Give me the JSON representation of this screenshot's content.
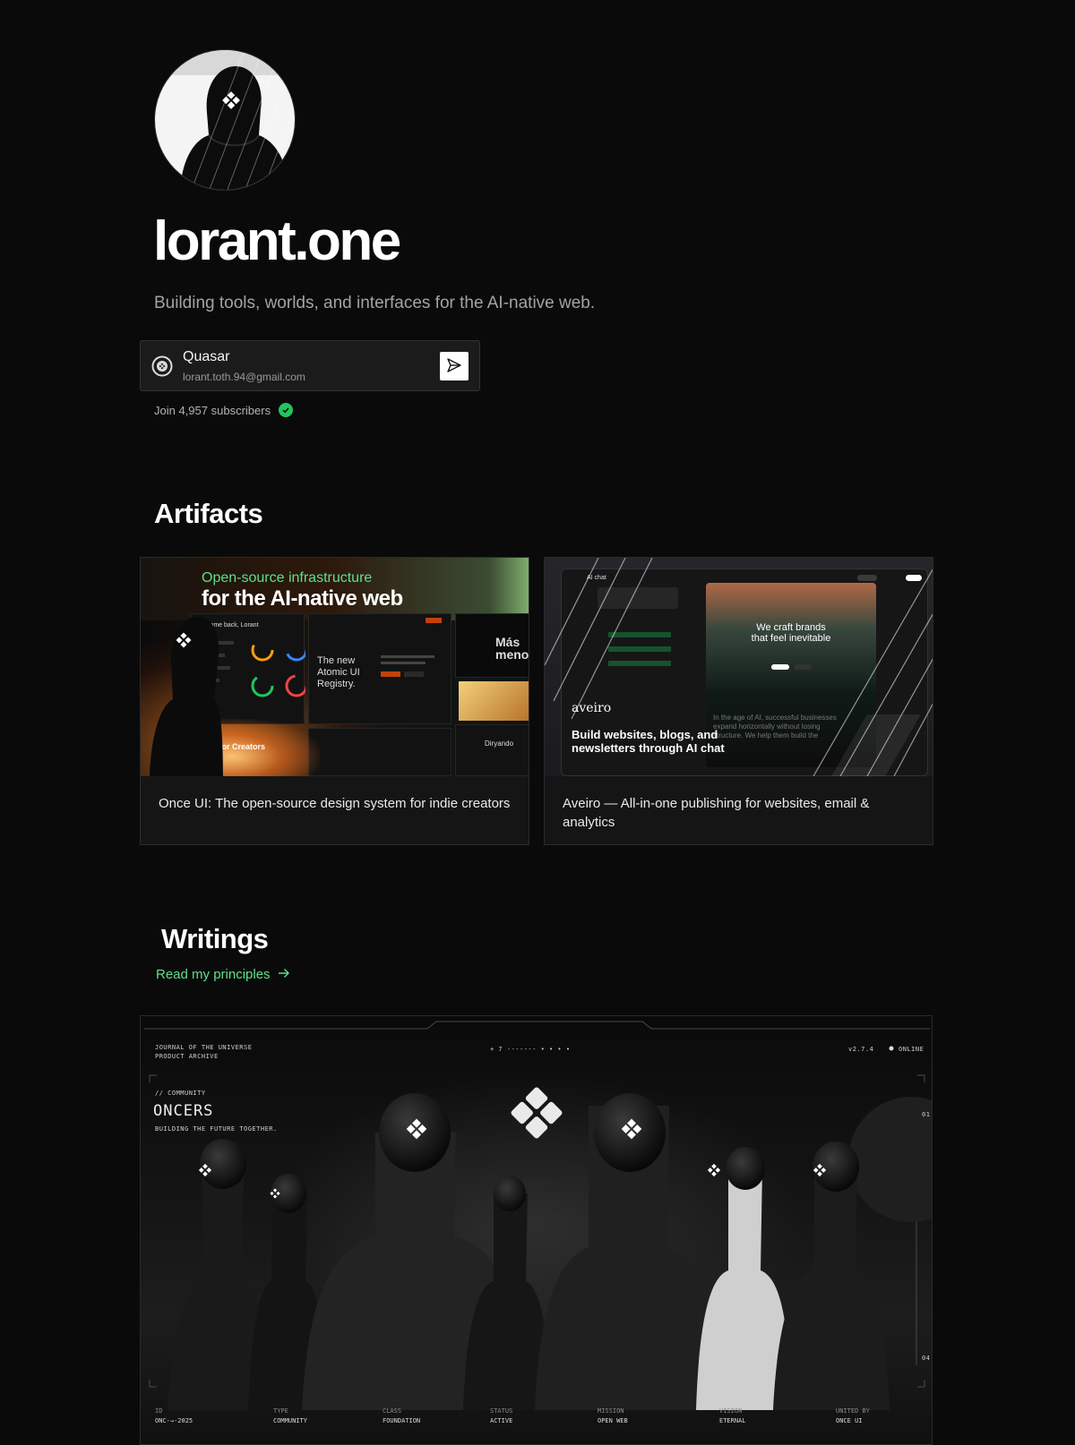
{
  "hero": {
    "brand": "lorant.one",
    "tagline": "Building tools, worlds, and interfaces for the AI-native web."
  },
  "subscribe": {
    "name": "Quasar",
    "email": "lorant.toth.94@gmail.com",
    "send_icon": "send-icon",
    "count_text": "Join 4,957 subscribers",
    "badge_icon": "check-icon",
    "badge_color": "#22c55e"
  },
  "artifacts": {
    "title": "Artifacts",
    "cards": [
      {
        "caption": "Once UI: The open-source design system for indie creators",
        "media": {
          "headline_1": "Open-source infrastructure",
          "headline_2": "for the AI-native web",
          "panel_1": "Welcome back, Lorant",
          "panel_2": "The new Atomic UI Registry.",
          "panel_3": "Más meno",
          "panel_4": "Diryando",
          "creators": "Home for Creators"
        }
      },
      {
        "caption": "Aveiro — All-in-one publishing for websites, email & analytics",
        "media": {
          "chat_label": "AI chat",
          "hero_1": "We craft brands",
          "hero_2": "that feel inevitable",
          "brand": "aveiro",
          "subline": "Build websites, blogs, and newsletters through AI chat",
          "body": "In the age of AI, successful businesses expand horizontally without losing structure. We help them build the"
        }
      }
    ]
  },
  "writings": {
    "title": "Writings",
    "link_label": "Read my principles",
    "link_icon": "arrow-right-icon",
    "accent": "#5ee08a",
    "feature": {
      "top_left_1": "JOURNAL OF THE UNIVERSE",
      "top_left_2": "PRODUCT ARCHIVE",
      "top_center": "+ 7 ------- • • • •",
      "version": "v2.7.4",
      "status": "ONLINE",
      "kicker": "// COMMUNITY",
      "title": "ONCERS",
      "subtitle": "BUILDING THE FUTURE TOGETHER.",
      "side_1": "01",
      "side_2": "04",
      "footer": [
        {
          "k": "ID",
          "v": "ONC-→-2025"
        },
        {
          "k": "TYPE",
          "v": "COMMUNITY"
        },
        {
          "k": "CLASS",
          "v": "FOUNDATION"
        },
        {
          "k": "STATUS",
          "v": "ACTIVE"
        },
        {
          "k": "MISSION",
          "v": "OPEN WEB"
        },
        {
          "k": "VISION",
          "v": "ETERNAL"
        },
        {
          "k": "UNITED BY",
          "v": "ONCE UI"
        }
      ]
    }
  }
}
